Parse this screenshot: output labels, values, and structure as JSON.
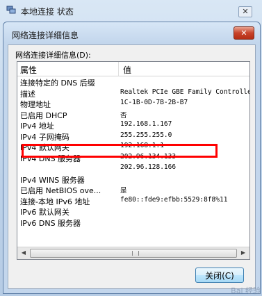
{
  "outer_window": {
    "title": "本地连接 状态",
    "close_glyph": "✕"
  },
  "dialog": {
    "title": "网络连接详细信息",
    "close_glyph": "✕",
    "details_label": "网络连接详细信息(D):",
    "columns": {
      "property": "属性",
      "value": "值"
    },
    "rows": [
      {
        "property": "连接特定的 DNS 后缀",
        "value": ""
      },
      {
        "property": "描述",
        "value": "Realtek PCIe GBE Family Controlle"
      },
      {
        "property": "物理地址",
        "value": "1C-1B-0D-7B-2B-B7"
      },
      {
        "property": "已启用 DHCP",
        "value": "否"
      },
      {
        "property": "IPv4 地址",
        "value": "192.168.1.167"
      },
      {
        "property": "IPv4 子网掩码",
        "value": "255.255.255.0"
      },
      {
        "property": "IPv4 默认网关",
        "value": "192.168.1.1"
      },
      {
        "property": "IPv4 DNS 服务器",
        "value": "202.96.134.133"
      },
      {
        "property": "",
        "value": "202.96.128.166"
      },
      {
        "property": "IPv4 WINS 服务器",
        "value": ""
      },
      {
        "property": "已启用 NetBIOS ove...",
        "value": "是"
      },
      {
        "property": "连接-本地 IPv6 地址",
        "value": "fe80::fde9:efbb:5529:8f8%11"
      },
      {
        "property": "IPv6 默认网关",
        "value": ""
      },
      {
        "property": "IPv6 DNS 服务器",
        "value": ""
      }
    ],
    "close_button": "关闭(C)"
  },
  "scrollbar": {
    "left_arrow": "◀",
    "right_arrow": "▶"
  },
  "highlight_color": "#ff0000",
  "watermark": "Bai 经验"
}
